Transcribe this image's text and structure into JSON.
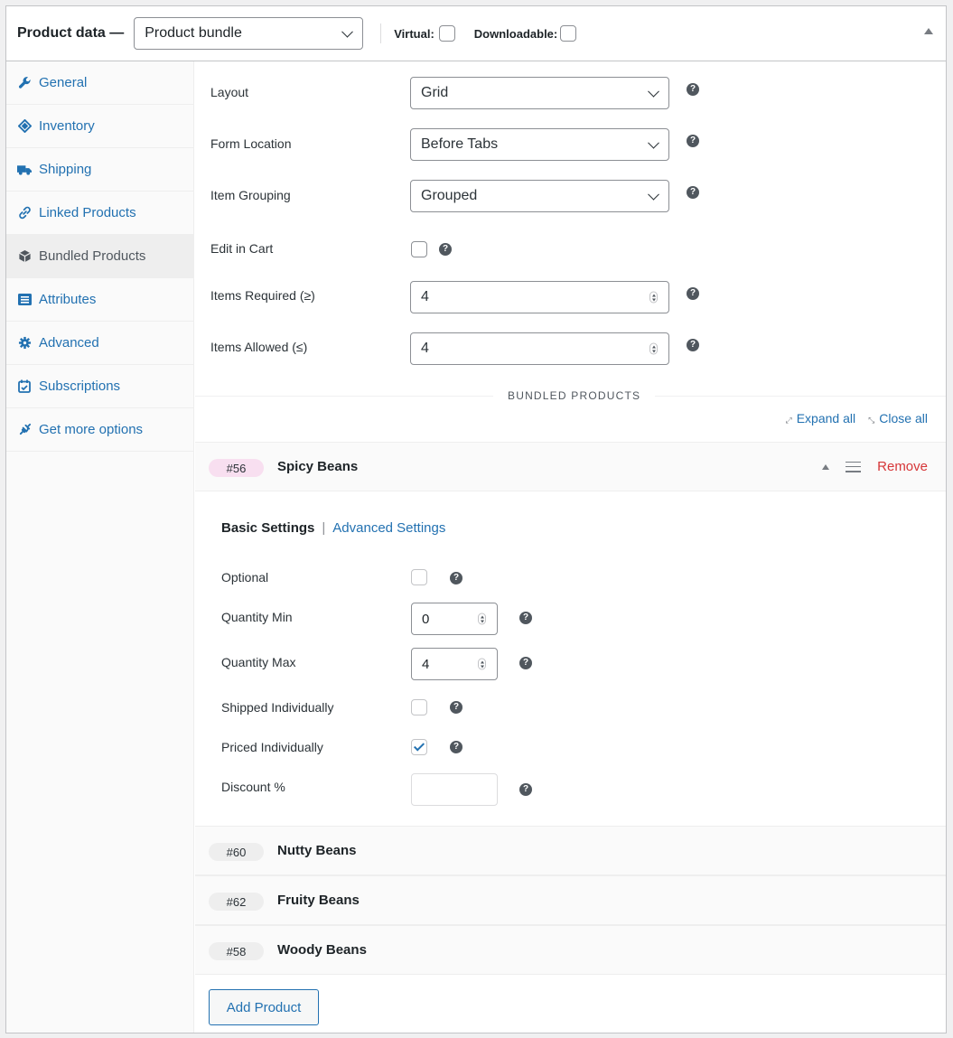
{
  "header": {
    "title": "Product data —",
    "product_type": "Product bundle",
    "virtual_label": "Virtual:",
    "downloadable_label": "Downloadable:"
  },
  "sidebar": {
    "items": [
      {
        "label": "General",
        "icon": "wrench-icon"
      },
      {
        "label": "Inventory",
        "icon": "tag-icon"
      },
      {
        "label": "Shipping",
        "icon": "truck-icon"
      },
      {
        "label": "Linked Products",
        "icon": "link-icon"
      },
      {
        "label": "Bundled Products",
        "icon": "cube-icon"
      },
      {
        "label": "Attributes",
        "icon": "list-icon"
      },
      {
        "label": "Advanced",
        "icon": "gear-icon"
      },
      {
        "label": "Subscriptions",
        "icon": "calendar-check-icon"
      },
      {
        "label": "Get more options",
        "icon": "plug-icon"
      }
    ],
    "active_index": 4
  },
  "settings": {
    "layout": {
      "label": "Layout",
      "value": "Grid"
    },
    "form_location": {
      "label": "Form Location",
      "value": "Before Tabs"
    },
    "item_grouping": {
      "label": "Item Grouping",
      "value": "Grouped"
    },
    "edit_in_cart": {
      "label": "Edit in Cart",
      "checked": false
    },
    "items_required": {
      "label": "Items Required (≥)",
      "value": "4"
    },
    "items_allowed": {
      "label": "Items Allowed (≤)",
      "value": "4"
    }
  },
  "bundled": {
    "section_title": "BUNDLED PRODUCTS",
    "expand_all": "Expand all",
    "close_all": "Close all",
    "expanded_item": {
      "id": "#56",
      "name": "Spicy Beans",
      "remove_label": "Remove",
      "tabs": {
        "basic": "Basic Settings",
        "separator": "|",
        "advanced": "Advanced Settings"
      },
      "optional": {
        "label": "Optional",
        "checked": false
      },
      "quantity_min": {
        "label": "Quantity Min",
        "value": "0"
      },
      "quantity_max": {
        "label": "Quantity Max",
        "value": "4"
      },
      "shipped_individually": {
        "label": "Shipped Individually",
        "checked": false
      },
      "priced_individually": {
        "label": "Priced Individually",
        "checked": true
      },
      "discount": {
        "label": "Discount %",
        "value": ""
      }
    },
    "items": [
      {
        "id": "#60",
        "name": "Nutty Beans"
      },
      {
        "id": "#62",
        "name": "Fruity Beans"
      },
      {
        "id": "#58",
        "name": "Woody Beans"
      }
    ],
    "add_button": "Add Product"
  },
  "colors": {
    "link": "#2271b1",
    "remove": "#d63638",
    "id_badge_active": "#f8dff0"
  }
}
